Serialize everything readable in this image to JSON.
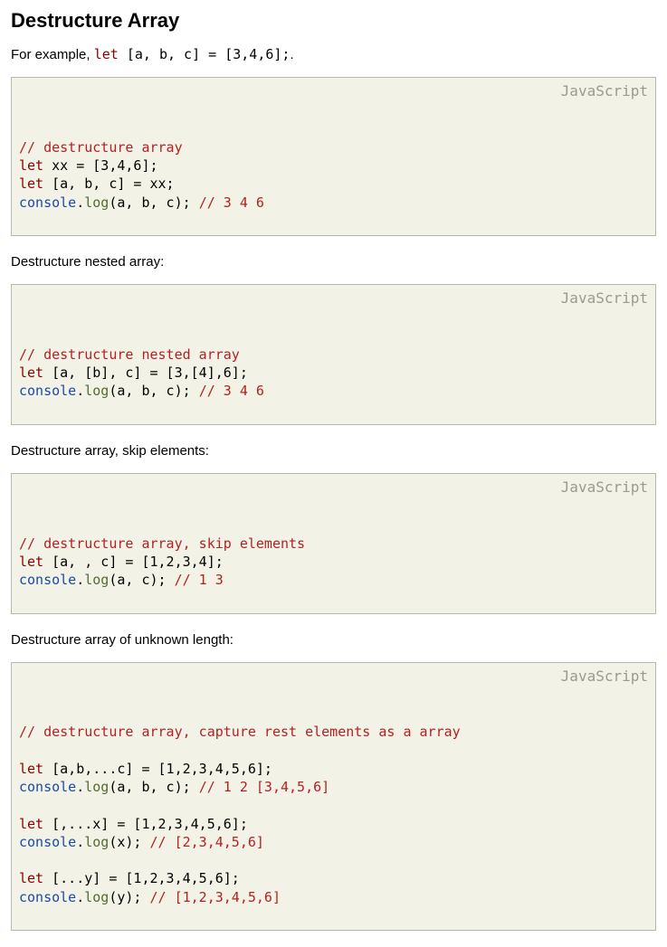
{
  "heading": "Destructure Array",
  "intro_prefix": "For example, ",
  "intro_code_tokens": [
    {
      "cls": "tok-keyword",
      "t": "let"
    },
    {
      "cls": "tok-plain",
      "t": " [a, b, c] = [3,4,6];"
    }
  ],
  "intro_suffix": ".",
  "lang_label": "JavaScript",
  "para_nested": "Destructure nested array:",
  "para_skip": "Destructure array, skip elements:",
  "para_unknown": "Destructure array of unknown length:",
  "blocks": {
    "b1": [
      [
        {
          "cls": "tok-comment",
          "t": "// destructure array"
        }
      ],
      [
        {
          "cls": "tok-keyword",
          "t": "let"
        },
        {
          "cls": "tok-plain",
          "t": " xx = [3,4,6];"
        }
      ],
      [
        {
          "cls": "tok-keyword",
          "t": "let"
        },
        {
          "cls": "tok-plain",
          "t": " [a, b, c] = xx;"
        }
      ],
      [
        {
          "cls": "tok-obj",
          "t": "console"
        },
        {
          "cls": "tok-plain",
          "t": "."
        },
        {
          "cls": "tok-method",
          "t": "log"
        },
        {
          "cls": "tok-plain",
          "t": "(a, b, c); "
        },
        {
          "cls": "tok-comment",
          "t": "// 3 4 6"
        }
      ]
    ],
    "b2": [
      [
        {
          "cls": "tok-comment",
          "t": "// destructure nested array"
        }
      ],
      [
        {
          "cls": "tok-keyword",
          "t": "let"
        },
        {
          "cls": "tok-plain",
          "t": " [a, [b], c] = [3,[4],6];"
        }
      ],
      [
        {
          "cls": "tok-obj",
          "t": "console"
        },
        {
          "cls": "tok-plain",
          "t": "."
        },
        {
          "cls": "tok-method",
          "t": "log"
        },
        {
          "cls": "tok-plain",
          "t": "(a, b, c); "
        },
        {
          "cls": "tok-comment",
          "t": "// 3 4 6"
        }
      ]
    ],
    "b3": [
      [
        {
          "cls": "tok-comment",
          "t": "// destructure array, skip elements"
        }
      ],
      [
        {
          "cls": "tok-keyword",
          "t": "let"
        },
        {
          "cls": "tok-plain",
          "t": " [a, , c] = [1,2,3,4];"
        }
      ],
      [
        {
          "cls": "tok-obj",
          "t": "console"
        },
        {
          "cls": "tok-plain",
          "t": "."
        },
        {
          "cls": "tok-method",
          "t": "log"
        },
        {
          "cls": "tok-plain",
          "t": "(a, c); "
        },
        {
          "cls": "tok-comment",
          "t": "// 1 3"
        }
      ]
    ],
    "b4": [
      [
        {
          "cls": "tok-comment",
          "t": "// destructure array, capture rest elements as a array"
        }
      ],
      [],
      [
        {
          "cls": "tok-keyword",
          "t": "let"
        },
        {
          "cls": "tok-plain",
          "t": " [a,b,...c] = [1,2,3,4,5,6];"
        }
      ],
      [
        {
          "cls": "tok-obj",
          "t": "console"
        },
        {
          "cls": "tok-plain",
          "t": "."
        },
        {
          "cls": "tok-method",
          "t": "log"
        },
        {
          "cls": "tok-plain",
          "t": "(a, b, c); "
        },
        {
          "cls": "tok-comment",
          "t": "// 1 2 [3,4,5,6]"
        }
      ],
      [],
      [
        {
          "cls": "tok-keyword",
          "t": "let"
        },
        {
          "cls": "tok-plain",
          "t": " [,...x] = [1,2,3,4,5,6];"
        }
      ],
      [
        {
          "cls": "tok-obj",
          "t": "console"
        },
        {
          "cls": "tok-plain",
          "t": "."
        },
        {
          "cls": "tok-method",
          "t": "log"
        },
        {
          "cls": "tok-plain",
          "t": "(x); "
        },
        {
          "cls": "tok-comment",
          "t": "// [2,3,4,5,6]"
        }
      ],
      [],
      [
        {
          "cls": "tok-keyword",
          "t": "let"
        },
        {
          "cls": "tok-plain",
          "t": " [...y] = [1,2,3,4,5,6];"
        }
      ],
      [
        {
          "cls": "tok-obj",
          "t": "console"
        },
        {
          "cls": "tok-plain",
          "t": "."
        },
        {
          "cls": "tok-method",
          "t": "log"
        },
        {
          "cls": "tok-plain",
          "t": "(y); "
        },
        {
          "cls": "tok-comment",
          "t": "// [1,2,3,4,5,6]"
        }
      ]
    ]
  }
}
